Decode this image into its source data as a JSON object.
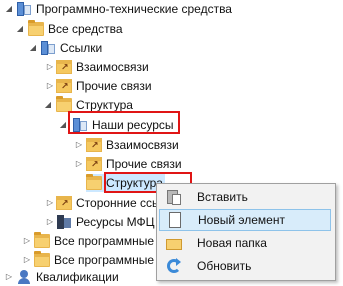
{
  "tree": {
    "items": [
      {
        "label": "Программно-технические средства"
      },
      {
        "label": "Все средства"
      },
      {
        "label": "Ссылки"
      },
      {
        "label": "Взаимосвязи"
      },
      {
        "label": "Прочие связи"
      },
      {
        "label": "Структура"
      },
      {
        "label": "Наши ресурсы"
      },
      {
        "label": "Взаимосвязи"
      },
      {
        "label": "Прочие связи"
      },
      {
        "label": "Структура"
      },
      {
        "label": "Сторонние ссыл"
      },
      {
        "label": "Ресурсы МФЦ"
      },
      {
        "label": "Все программные"
      },
      {
        "label": "Все программные"
      },
      {
        "label": "Квалификации"
      }
    ]
  },
  "context_menu": {
    "items": [
      {
        "label": "Вставить",
        "icon": "paste-icon"
      },
      {
        "label": "Новый элемент",
        "icon": "new-item-icon"
      },
      {
        "label": "Новая папка",
        "icon": "new-folder-icon"
      },
      {
        "label": "Обновить",
        "icon": "refresh-icon"
      }
    ]
  },
  "colors": {
    "highlight_box": "#e01515",
    "selection": "#cce8ff",
    "menu_hover": "#d8ecfa"
  }
}
